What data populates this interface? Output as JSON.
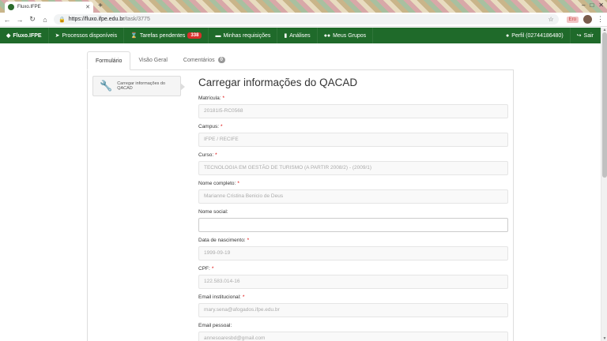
{
  "browser": {
    "tab_title": "Fluxo.IFPE",
    "url_host": "https://fluxo.ifpe.edu.br",
    "url_path": "/task/3775",
    "extension_badge": "Ero"
  },
  "nav": {
    "brand": "Fluxo.IFPE",
    "items": [
      {
        "label": "Processos disponíveis"
      },
      {
        "label": "Tarefas pendentes",
        "badge": "338"
      },
      {
        "label": "Minhas requisições"
      },
      {
        "label": "Análises"
      },
      {
        "label": "Meus Grupos"
      }
    ],
    "profile": "Perfil (02744186480)",
    "logout": "Sair"
  },
  "tabs": [
    {
      "label": "Formulário",
      "active": true
    },
    {
      "label": "Visão Geral"
    },
    {
      "label": "Comentários",
      "count": "0"
    }
  ],
  "sidebar": {
    "step_label": "Carregar informações do QACAD"
  },
  "form": {
    "title": "Carregar informações do QACAD",
    "fields": [
      {
        "label": "Matrícula:",
        "required": "*",
        "value": "20181I5-RC0568"
      },
      {
        "label": "Campus:",
        "required": "*",
        "value": "IFPE / RECIFE"
      },
      {
        "label": "Curso:",
        "required": "*",
        "value": "TECNOLOGIA EM GESTÃO DE TURISMO (A PARTIR 2008/2) - (2009/1)"
      },
      {
        "label": "Nome completo:",
        "required": "*",
        "value": "Marianne Cristina Benicio de Deus"
      },
      {
        "label": "Nome social:",
        "required": "",
        "value": ""
      },
      {
        "label": "Data de nascimento:",
        "required": "*",
        "value": "1999-09-19"
      },
      {
        "label": "CPF:",
        "required": "*",
        "value": "122.583.014-16"
      },
      {
        "label": "Email institucional:",
        "required": "*",
        "value": "mary.sena@afogados.ifpe.edu.br"
      },
      {
        "label": "Email pessoal:",
        "required": "",
        "value": "annesoaresbd@gmail.com"
      }
    ]
  },
  "colors": {
    "nav_green": "#1f6a2a",
    "badge_red": "#d9302c",
    "required_red": "#dd0000"
  }
}
